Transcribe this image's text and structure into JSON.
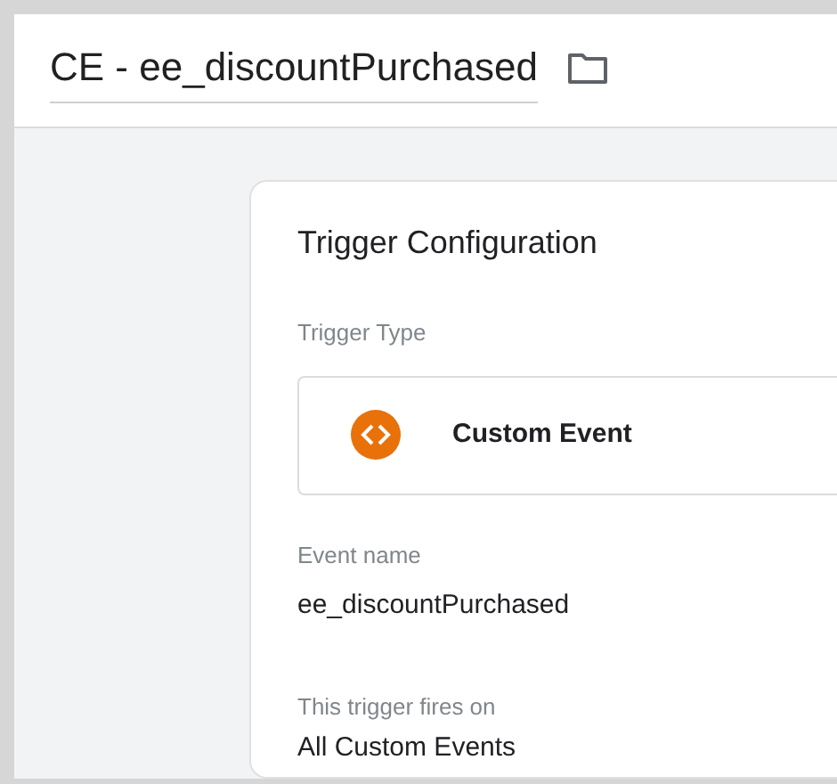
{
  "header": {
    "title": "CE - ee_discountPurchased"
  },
  "card": {
    "title": "Trigger Configuration",
    "trigger_type": {
      "label": "Trigger Type",
      "value": "Custom Event"
    },
    "event_name": {
      "label": "Event name",
      "value": "ee_discountPurchased"
    },
    "fires_on": {
      "label": "This trigger fires on",
      "value": "All Custom Events"
    }
  }
}
